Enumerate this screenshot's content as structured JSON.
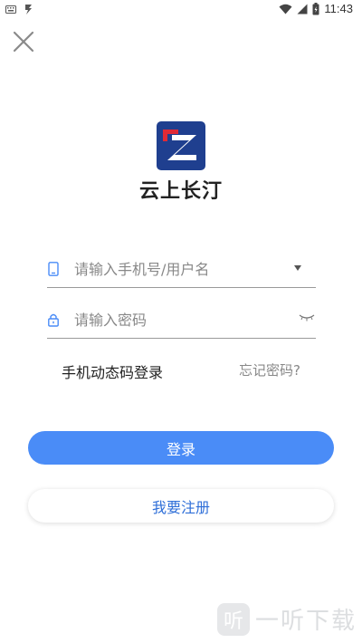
{
  "status_bar": {
    "time": "11:43",
    "icons": [
      "keyboard-icon",
      "notification-icon",
      "wifi-icon",
      "signal-icon",
      "battery-icon"
    ]
  },
  "header": {
    "close_icon": "close-icon"
  },
  "brand": {
    "app_name": "云上长汀",
    "logo_colors": {
      "background": "#1f3f8f",
      "accent": "#e02a36",
      "mark": "#ffffff"
    }
  },
  "form": {
    "username": {
      "placeholder": "请输入手机号/用户名",
      "value": "",
      "icon": "phone-icon",
      "trailing_icon": "dropdown-arrow-icon"
    },
    "password": {
      "placeholder": "请输入密码",
      "value": "",
      "icon": "lock-icon",
      "trailing_icon": "eye-closed-icon"
    }
  },
  "links": {
    "sms_login": "手机动态码登录",
    "forgot_password": "忘记密码?"
  },
  "buttons": {
    "login": "登录",
    "register": "我要注册"
  },
  "watermark": {
    "mark": "听",
    "text": "一听下载"
  },
  "colors": {
    "primary": "#4a8cf7",
    "link": "#2f6fd8",
    "muted_text": "#888888"
  }
}
